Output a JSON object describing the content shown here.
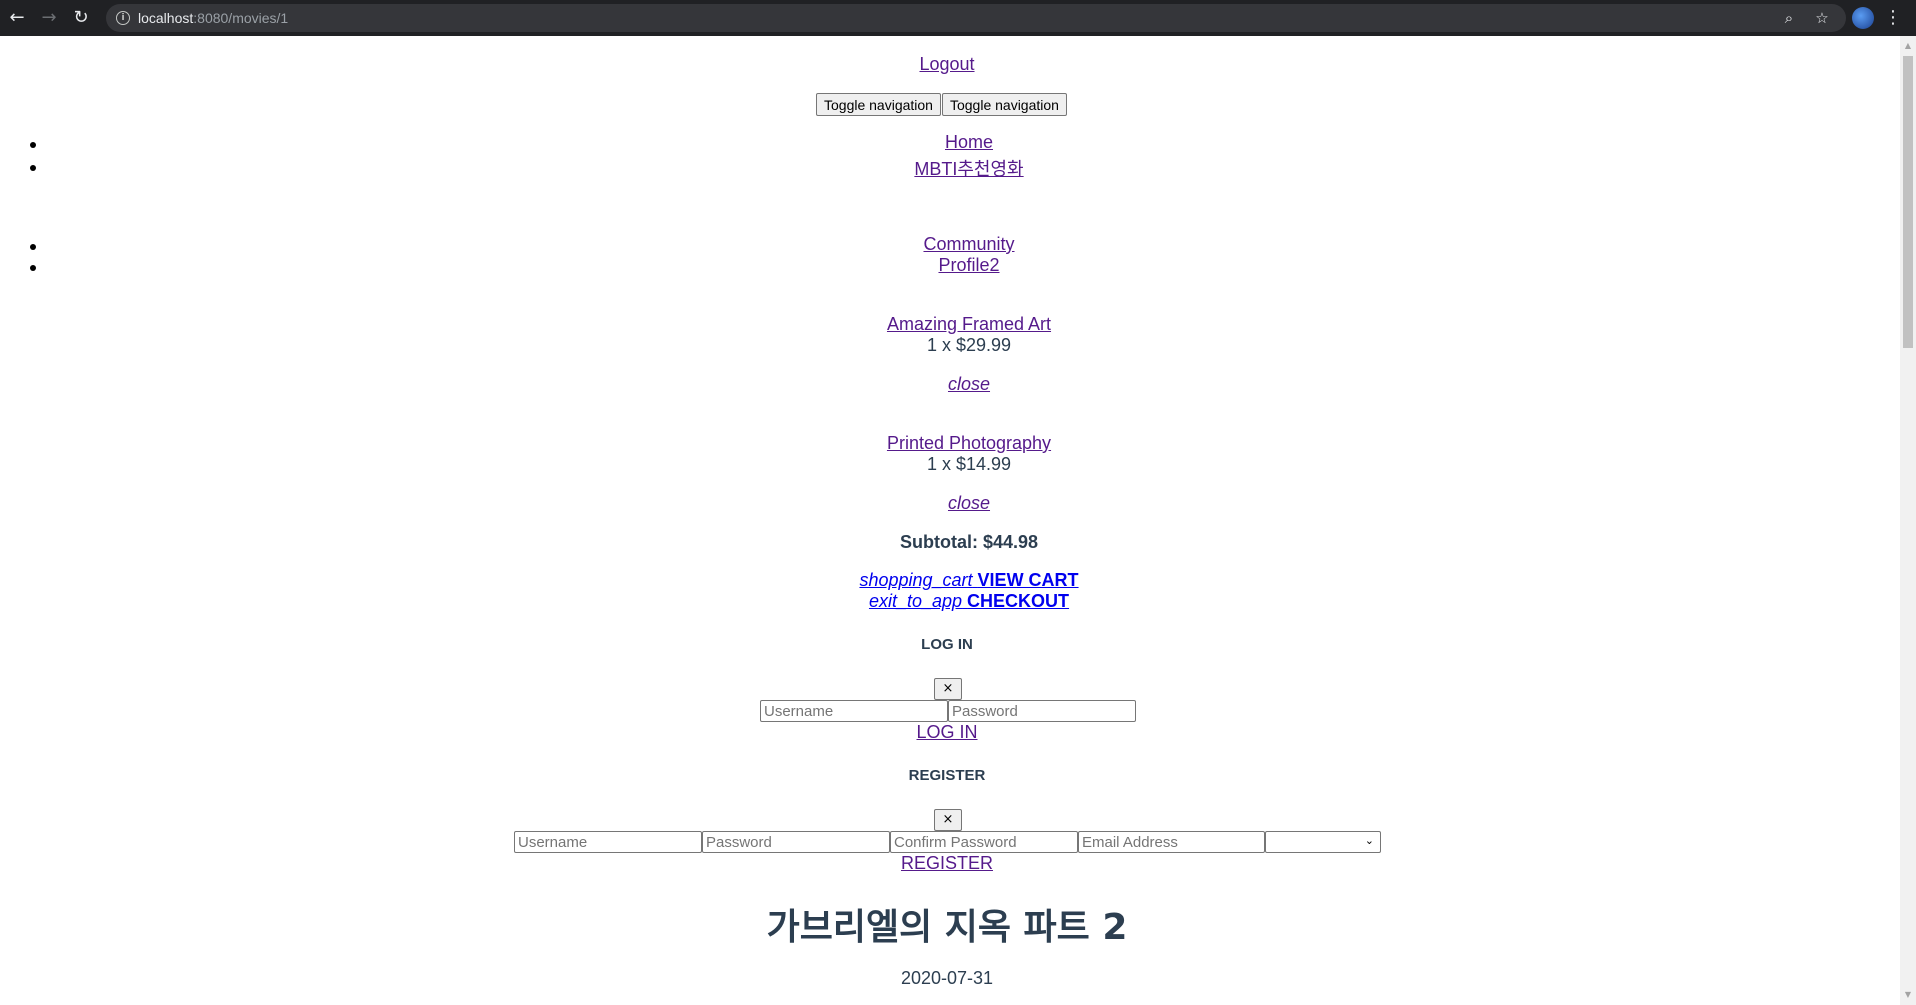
{
  "browser": {
    "url_host": "localhost",
    "url_rest": ":8080/movies/1",
    "back_icon": "arrow-left-icon",
    "forward_icon": "arrow-right-icon",
    "reload_icon": "reload-icon",
    "info_icon": "info-icon",
    "zoom_icon": "zoom-icon",
    "star_icon": "star-icon",
    "menu_icon": "kebab-menu-icon"
  },
  "header": {
    "logout_label": "Logout",
    "toggle_nav_1": "Toggle navigation",
    "toggle_nav_2": "Toggle navigation"
  },
  "nav": {
    "home": "Home",
    "mbti": "MBTI추천영화",
    "community": "Community",
    "profile": "Profile2"
  },
  "cart": {
    "items": [
      {
        "name": "Amazing Framed Art",
        "qty_price": "1 x $29.99",
        "close": "close"
      },
      {
        "name": "Printed Photography",
        "qty_price": "1 x $14.99",
        "close": "close"
      }
    ],
    "subtotal": "Subtotal: $44.98",
    "view_cart_icon": "shopping_cart",
    "view_cart_label": "VIEW CART",
    "checkout_icon": "exit_to_app",
    "checkout_label": "CHECKOUT"
  },
  "login": {
    "title": "LOG IN",
    "close": "×",
    "username_placeholder": "Username",
    "password_placeholder": "Password",
    "submit": "LOG IN"
  },
  "register": {
    "title": "REGISTER",
    "close": "×",
    "username_placeholder": "Username",
    "password_placeholder": "Password",
    "confirm_placeholder": "Confirm Password",
    "email_placeholder": "Email Address",
    "submit": "REGISTER"
  },
  "movie": {
    "title": "가브리엘의 지옥 파트 2",
    "date": "2020-07-31"
  }
}
